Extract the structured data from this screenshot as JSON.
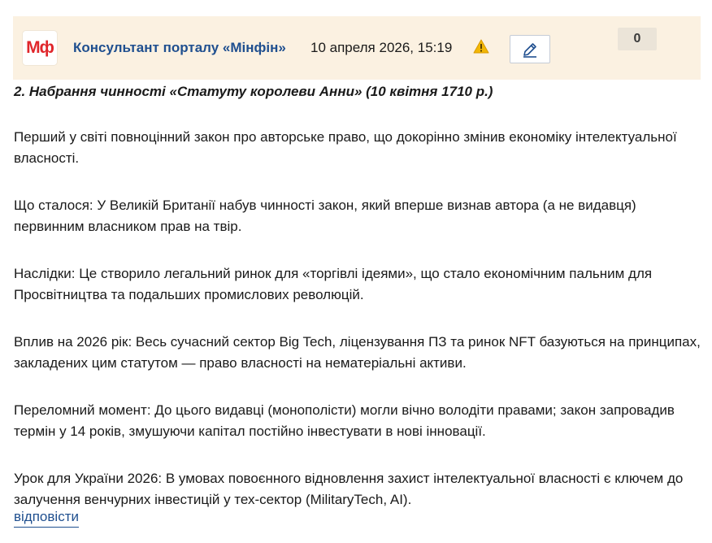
{
  "comment": {
    "logo_text": "Мф",
    "author": "Консультант порталу «Мінфін»",
    "date": "10 апреля 2026, 15:19",
    "counter": "0",
    "paragraphs": [
      "2. Набрання чинності «Статуту королеви Анни» (10 квітня 1710 р.)",
      "Перший у світі повноцінний закон про авторське право, що докорінно змінив економіку інтелектуальної власності.",
      "Що сталося: У Великій Британії набув чинності закон, який вперше визнав автора (а не видавця) первинним власником прав на твір.",
      "Наслідки: Це створило легальний ринок для «торгівлі ідеями», що стало економічним пальним для Просвітництва та подальших промислових революцій.",
      "Вплив на 2026 рік: Весь сучасний сектор Big Tech, ліцензування ПЗ та ринок NFT базуються на принципах, закладених цим статутом — право власності на нематеріальні активи.",
      "Переломний момент: До цього видавці (монополісти) могли вічно володіти правами; закон запровадив термін у 14 років, змушуючи капітал постійно інвестувати в нові інновації.",
      "Урок для України 2026: В умовах повоєнного відновлення захист інтелектуальної власності є ключем до залучення венчурних інвестицій у тех-сектор (MilitaryTech, AI)."
    ],
    "reply_label": "відповісти"
  },
  "icons": {
    "warning": "warning-icon",
    "edit": "pencil-icon"
  },
  "colors": {
    "header_bg": "#fbf1e1",
    "author": "#1f4f8f",
    "logo": "#e0262b",
    "warning": "#f2b705",
    "counter_bg": "#ebe4d8"
  }
}
